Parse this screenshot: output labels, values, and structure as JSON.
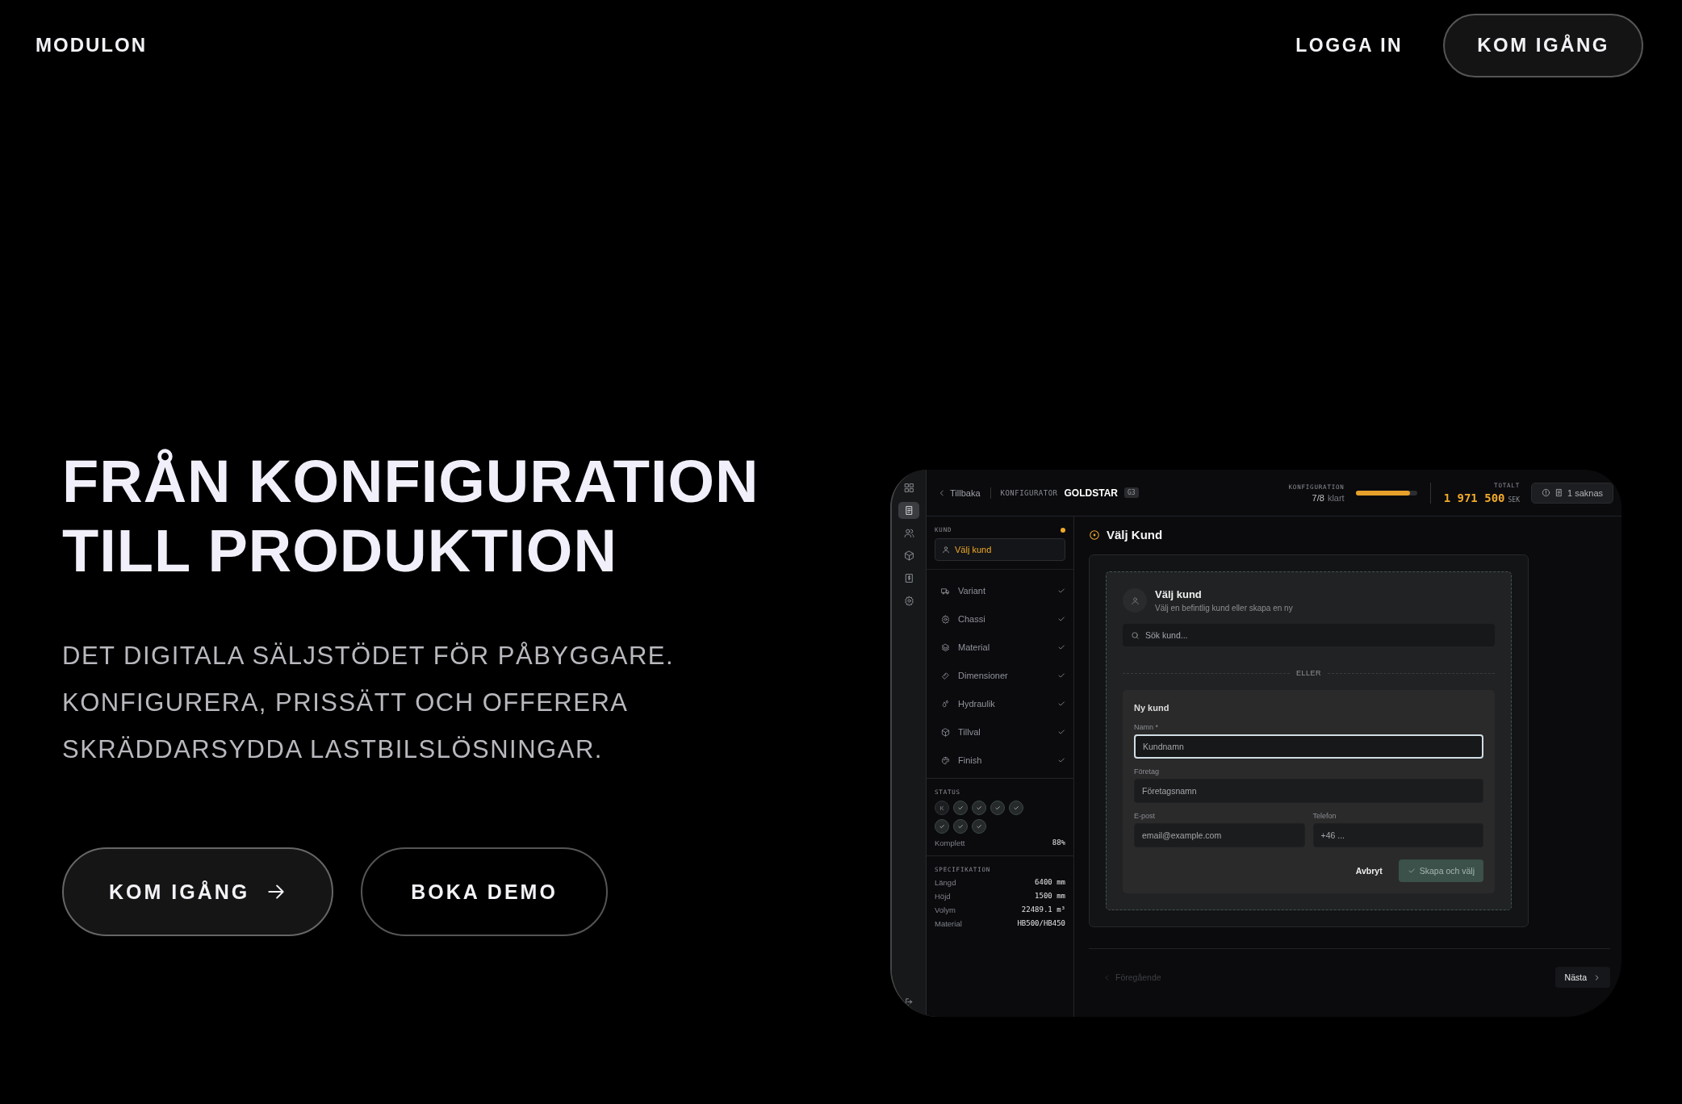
{
  "nav": {
    "brand": "MODULON",
    "login": "LOGGA IN",
    "cta": "KOM IGÅNG"
  },
  "hero": {
    "title_lines": [
      "FRÅN KONFIGURATION",
      "TILL PRODUKTION"
    ],
    "subtitle": "DET DIGITALA SÄLJSTÖDET FÖR PÅBYGGARE. KONFIGURERA, PRISSÄTT OCH OFFERERA SKRÄDDARSYDDA LASTBILSLÖSNINGAR.",
    "buttons": [
      {
        "label": "KOM IGÅNG",
        "kind": "primary"
      },
      {
        "label": "BOKA DEMO",
        "kind": "secondary"
      }
    ]
  },
  "app": {
    "topbar": {
      "back": "Tillbaka",
      "crumb": "KONFIGURATOR",
      "model": "GOLDSTAR",
      "badge": "G3",
      "progress": {
        "label": "KONFIGURATION",
        "count": "7/8",
        "suffix": "klart",
        "level": 0.88
      },
      "total": {
        "label": "TOTALT",
        "amount": "1 971 500",
        "currency": "SEK"
      },
      "missing": "1 saknas"
    },
    "rail": [
      {
        "kind": "grid",
        "selected": false
      },
      {
        "kind": "document",
        "selected": true
      },
      {
        "kind": "users",
        "selected": false
      },
      {
        "kind": "box",
        "selected": false
      },
      {
        "kind": "dollar",
        "selected": false
      },
      {
        "kind": "gear",
        "selected": false
      }
    ],
    "sidebar": {
      "customer": {
        "label": "KUND",
        "pending": true,
        "button": "Välj kund"
      },
      "steps": [
        {
          "label": "Variant",
          "done": true
        },
        {
          "label": "Chassi",
          "done": true
        },
        {
          "label": "Material",
          "done": true
        },
        {
          "label": "Dimensioner",
          "done": true
        },
        {
          "label": "Hydraulik",
          "done": true
        },
        {
          "label": "Tillval",
          "done": true
        },
        {
          "label": "Finish",
          "done": true
        }
      ],
      "status": {
        "label": "STATUS",
        "dots": [
          {
            "text": "K",
            "done": false
          },
          {
            "done": true
          },
          {
            "done": true
          },
          {
            "done": true
          },
          {
            "done": true
          },
          {
            "done": true
          },
          {
            "done": true
          },
          {
            "done": true
          }
        ],
        "complete_label": "Komplett",
        "complete_value": "88%"
      },
      "spec": {
        "label": "SPECIFIKATION",
        "rows": [
          {
            "name": "Längd",
            "value": "6400 mm"
          },
          {
            "name": "Höjd",
            "value": "1500 mm"
          },
          {
            "name": "Volym",
            "value": "22489.1 m³"
          },
          {
            "name": "Material",
            "value": "HB500/HB450"
          }
        ]
      }
    },
    "main": {
      "heading": "Välj Kund",
      "card": {
        "title": "Välj kund",
        "subtitle": "Välj en befintlig kund eller skapa en ny",
        "search_placeholder": "Sök kund...",
        "divider": "ELLER",
        "form": {
          "title": "Ny kund",
          "fields": [
            {
              "label": "Namn *",
              "placeholder": "Kundnamn",
              "focused": true
            },
            {
              "label": "Företag",
              "placeholder": "Företagsnamn",
              "focused": false
            }
          ],
          "contact_fields": [
            {
              "label": "E-post",
              "placeholder": "email@example.com",
              "focused": false
            },
            {
              "label": "Telefon",
              "placeholder": "+46 ...",
              "focused": false
            }
          ],
          "cancel": "Avbryt",
          "submit": "Skapa och välj"
        }
      },
      "footer": {
        "prev": "Föregående",
        "prev_disabled": true,
        "next": "Nästa"
      }
    }
  }
}
